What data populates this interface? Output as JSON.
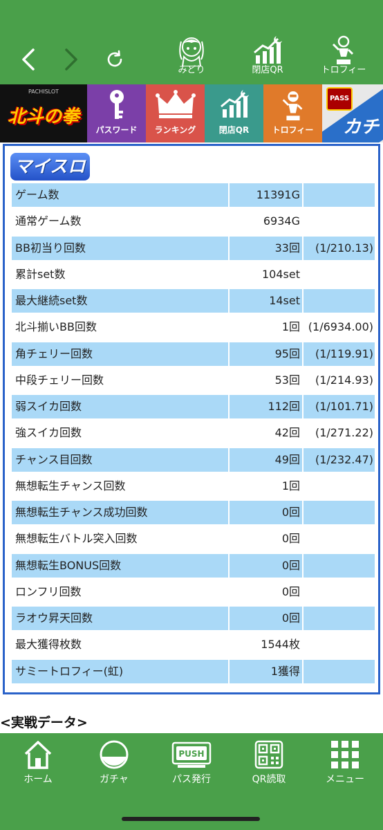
{
  "header": {
    "icons": [
      {
        "name": "midori",
        "label": "みどり"
      },
      {
        "name": "closing-qr",
        "label": "閉店QR"
      },
      {
        "name": "trophy",
        "label": "トロフィー"
      }
    ]
  },
  "categories": {
    "logo_sub": "PACHISLOT",
    "logo_title": "北斗の拳",
    "items": [
      {
        "label": "パスワード"
      },
      {
        "label": "ランキング"
      },
      {
        "label": "閉店QR"
      },
      {
        "label": "トロフィー"
      }
    ],
    "pass_badge": "PASS",
    "kachi": "カチ"
  },
  "panel": {
    "brand": "マイスロ",
    "rows": [
      {
        "label": "ゲーム数",
        "value": "11391G",
        "rate": ""
      },
      {
        "label": "通常ゲーム数",
        "value": "6934G",
        "rate": ""
      },
      {
        "label": "BB初当り回数",
        "value": "33回",
        "rate": "(1/210.13)"
      },
      {
        "label": "累計set数",
        "value": "104set",
        "rate": ""
      },
      {
        "label": "最大継続set数",
        "value": "14set",
        "rate": ""
      },
      {
        "label": "北斗揃いBB回数",
        "value": "1回",
        "rate": "(1/6934.00)"
      },
      {
        "label": "角チェリー回数",
        "value": "95回",
        "rate": "(1/119.91)"
      },
      {
        "label": "中段チェリー回数",
        "value": "53回",
        "rate": "(1/214.93)"
      },
      {
        "label": "弱スイカ回数",
        "value": "112回",
        "rate": "(1/101.71)"
      },
      {
        "label": "強スイカ回数",
        "value": "42回",
        "rate": "(1/271.22)"
      },
      {
        "label": "チャンス目回数",
        "value": "49回",
        "rate": "(1/232.47)"
      },
      {
        "label": "無想転生チャンス回数",
        "value": "1回",
        "rate": ""
      },
      {
        "label": "無想転生チャンス成功回数",
        "value": "0回",
        "rate": ""
      },
      {
        "label": "無想転生バトル突入回数",
        "value": "0回",
        "rate": ""
      },
      {
        "label": "無想転生BONUS回数",
        "value": "0回",
        "rate": ""
      },
      {
        "label": "ロンフリ回数",
        "value": "0回",
        "rate": ""
      },
      {
        "label": "ラオウ昇天回数",
        "value": "0回",
        "rate": ""
      },
      {
        "label": "最大獲得枚数",
        "value": "1544枚",
        "rate": ""
      },
      {
        "label": "サミートロフィー(虹)",
        "value": "1獲得",
        "rate": ""
      }
    ],
    "section_title": "<実戦データ>"
  },
  "tabs": [
    {
      "label": "ホーム"
    },
    {
      "label": "ガチャ"
    },
    {
      "label": "パス発行",
      "badge": "PUSH"
    },
    {
      "label": "QR読取"
    },
    {
      "label": "メニュー"
    }
  ],
  "colors": {
    "green": "#4aa04a",
    "row_blue": "#aad9f7",
    "panel_border": "#2a62c9"
  }
}
